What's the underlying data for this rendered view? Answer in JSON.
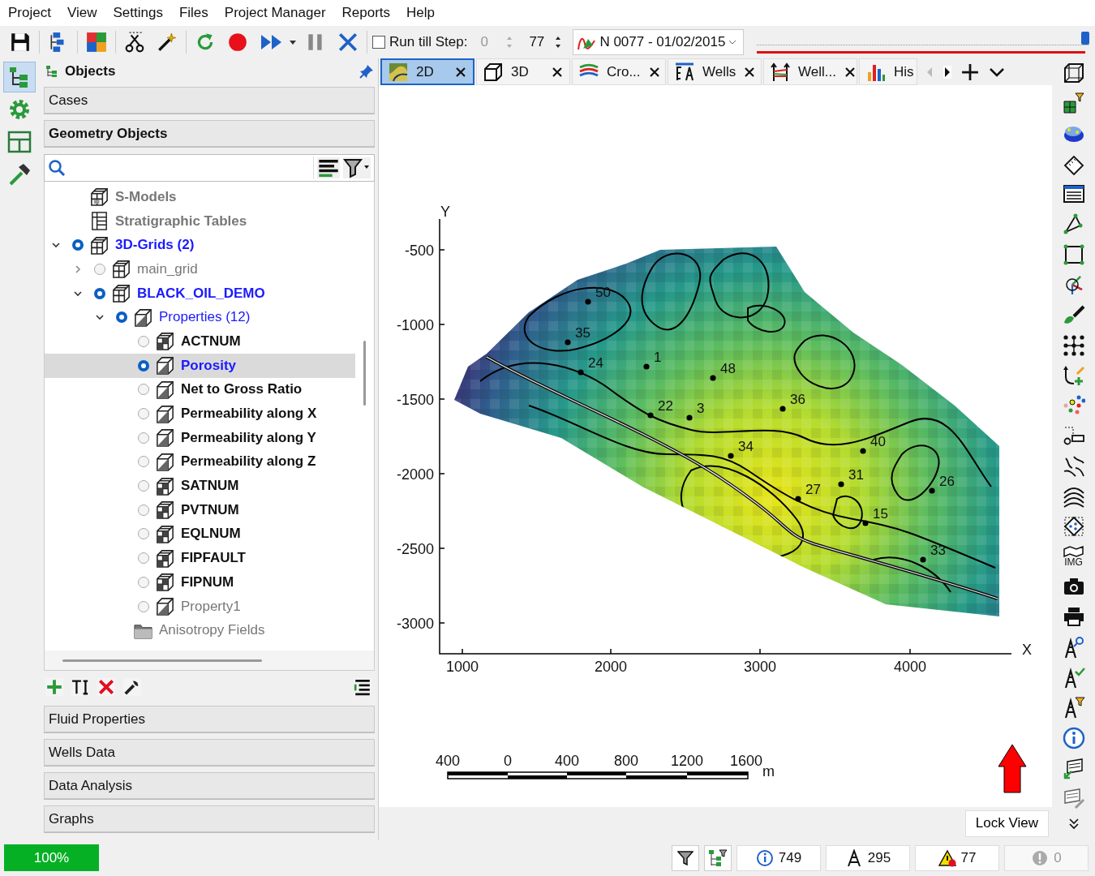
{
  "menu": [
    "Project",
    "View",
    "Settings",
    "Files",
    "Project Manager",
    "Reports",
    "Help"
  ],
  "toolbar": {
    "run_till_step": {
      "label": "Run till Step:",
      "checked": false
    },
    "step_value": "0",
    "step_count": "77",
    "timestep": "N 0077 - 01/02/2015",
    "timeline": {
      "level": 0.99
    }
  },
  "left_strip": [
    {
      "kind": "tree",
      "selected": true
    },
    {
      "kind": "gear",
      "selected": false
    },
    {
      "kind": "layout",
      "selected": false
    },
    {
      "kind": "hammer",
      "selected": false
    }
  ],
  "objects_panel": {
    "title": "Objects",
    "sections_top": [
      "Cases",
      "Geometry Objects"
    ],
    "tree": [
      {
        "label": "S-Models",
        "kind": "smodel",
        "bold": true,
        "disabled": true,
        "selected": false
      },
      {
        "label": "Stratigraphic Tables",
        "kind": "table",
        "bold": true,
        "disabled": true,
        "selected": false
      },
      {
        "label": "3D-Grids (2)",
        "kind": "grid",
        "bold": true,
        "disabled": false,
        "checked": true,
        "expanded": true,
        "selected": false,
        "children": [
          {
            "label": "main_grid",
            "kind": "grid",
            "bold": false,
            "disabled": true,
            "checked": false,
            "expanded": false,
            "selected": false
          },
          {
            "label": "BLACK_OIL_DEMO",
            "kind": "grid",
            "bold": true,
            "disabled": false,
            "checked": true,
            "expanded": true,
            "selected": false,
            "children": [
              {
                "label": "Properties (12)",
                "kind": "cube",
                "bold": false,
                "disabled": false,
                "checked": true,
                "expanded": true,
                "selected": false,
                "children": [
                  {
                    "label": "ACTNUM",
                    "kind": "cubegrid",
                    "bold": true,
                    "disabled": false,
                    "checked": false,
                    "selected": false
                  },
                  {
                    "label": "Porosity",
                    "kind": "cube",
                    "bold": true,
                    "disabled": false,
                    "checked": true,
                    "selected": true
                  },
                  {
                    "label": "Net to Gross Ratio",
                    "kind": "cube",
                    "bold": true,
                    "disabled": false,
                    "checked": false,
                    "selected": false
                  },
                  {
                    "label": "Permeability along X",
                    "kind": "cube",
                    "bold": true,
                    "disabled": false,
                    "checked": false,
                    "selected": false
                  },
                  {
                    "label": "Permeability along Y",
                    "kind": "cube",
                    "bold": true,
                    "disabled": false,
                    "checked": false,
                    "selected": false
                  },
                  {
                    "label": "Permeability along Z",
                    "kind": "cube",
                    "bold": true,
                    "disabled": false,
                    "checked": false,
                    "selected": false
                  },
                  {
                    "label": "SATNUM",
                    "kind": "cubegrid",
                    "bold": true,
                    "disabled": false,
                    "checked": false,
                    "selected": false
                  },
                  {
                    "label": "PVTNUM",
                    "kind": "cubegrid",
                    "bold": true,
                    "disabled": false,
                    "checked": false,
                    "selected": false
                  },
                  {
                    "label": "EQLNUM",
                    "kind": "cubegrid",
                    "bold": true,
                    "disabled": false,
                    "checked": false,
                    "selected": false
                  },
                  {
                    "label": "FIPFAULT",
                    "kind": "cubegrid",
                    "bold": true,
                    "disabled": false,
                    "checked": false,
                    "selected": false
                  },
                  {
                    "label": "FIPNUM",
                    "kind": "cubegrid",
                    "bold": true,
                    "disabled": false,
                    "checked": false,
                    "selected": false
                  },
                  {
                    "label": "Property1",
                    "kind": "cube",
                    "bold": false,
                    "disabled": true,
                    "checked": false,
                    "selected": false
                  }
                ]
              },
              {
                "label": "Anisotropy Fields",
                "kind": "folder",
                "bold": false,
                "disabled": true,
                "selected": false
              }
            ]
          }
        ]
      }
    ],
    "sections_bottom": [
      "Fluid Properties",
      "Wells Data",
      "Data Analysis",
      "Graphs"
    ]
  },
  "tabs": [
    {
      "label": "2D",
      "kind": "map",
      "selected": true
    },
    {
      "label": "3D",
      "kind": "cube",
      "selected": false
    },
    {
      "label": "Cro...",
      "kind": "section",
      "selected": false
    },
    {
      "label": "Wells",
      "kind": "wells",
      "selected": false
    },
    {
      "label": "Well...",
      "kind": "wellsection",
      "selected": false
    },
    {
      "label": "His",
      "kind": "histogram",
      "selected": false
    }
  ],
  "plot": {
    "y_axis_label": "Y",
    "x_axis_label": "X",
    "y_ticks": [
      "-500",
      "-1000",
      "-1500",
      "-2000",
      "-2500",
      "-3000"
    ],
    "x_ticks": [
      "1000",
      "2000",
      "3000",
      "4000"
    ],
    "wells": [
      "50",
      "35",
      "24",
      "1",
      "48",
      "22",
      "3",
      "36",
      "34",
      "40",
      "31",
      "27",
      "26",
      "15",
      "33"
    ],
    "scale_labels": [
      "400",
      "0",
      "400",
      "800",
      "1200",
      "1600"
    ],
    "scale_unit": "m"
  },
  "lock_view": "Lock View",
  "side_tools": {
    "image_label": "IMG"
  },
  "status": {
    "progress": {
      "level": 1,
      "label": "100%"
    },
    "counters": [
      {
        "kind": "info",
        "value": "749",
        "disabled": false
      },
      {
        "kind": "well",
        "value": "295",
        "disabled": false
      },
      {
        "kind": "warning",
        "value": "77",
        "disabled": false
      },
      {
        "kind": "error",
        "value": "0",
        "disabled": true
      }
    ]
  }
}
